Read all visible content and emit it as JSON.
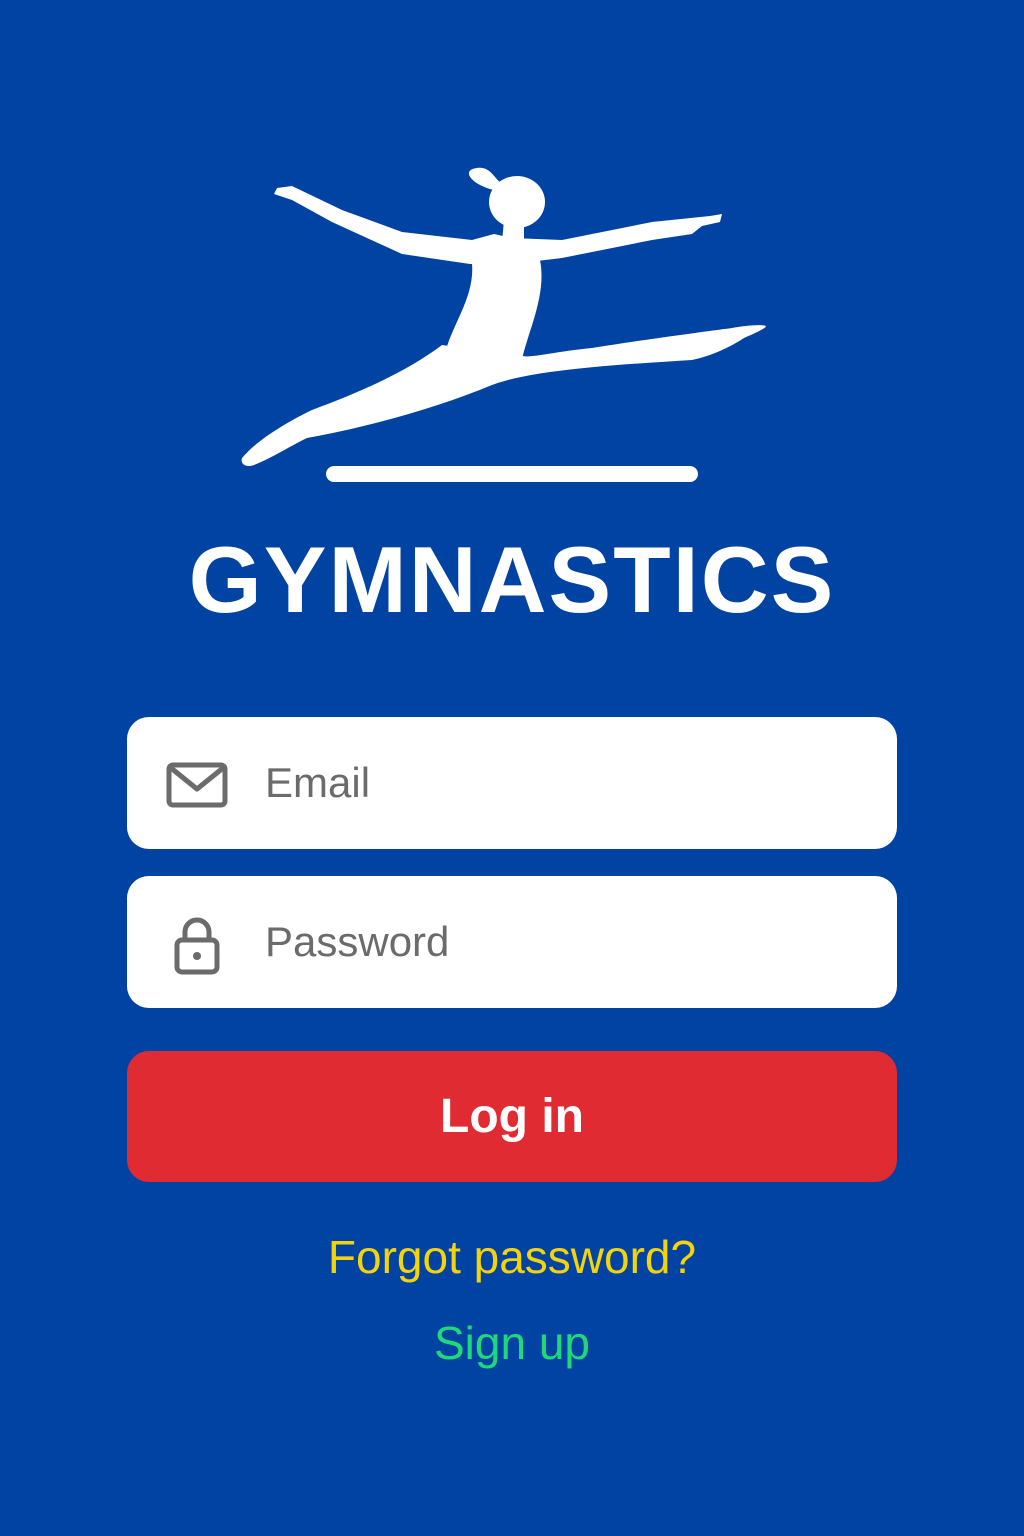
{
  "app": {
    "title": "GYMNASTICS"
  },
  "login_form": {
    "email": {
      "placeholder": "Email",
      "icon": "envelope-icon"
    },
    "password": {
      "placeholder": "Password",
      "icon": "lock-icon"
    },
    "submit_label": "Log in",
    "forgot_label": "Forgot password?",
    "signup_label": "Sign up"
  },
  "colors": {
    "background": "#0043a3",
    "login_button": "#e02b32",
    "forgot_link": "#f5d30a",
    "signup_link": "#1ed97a"
  }
}
